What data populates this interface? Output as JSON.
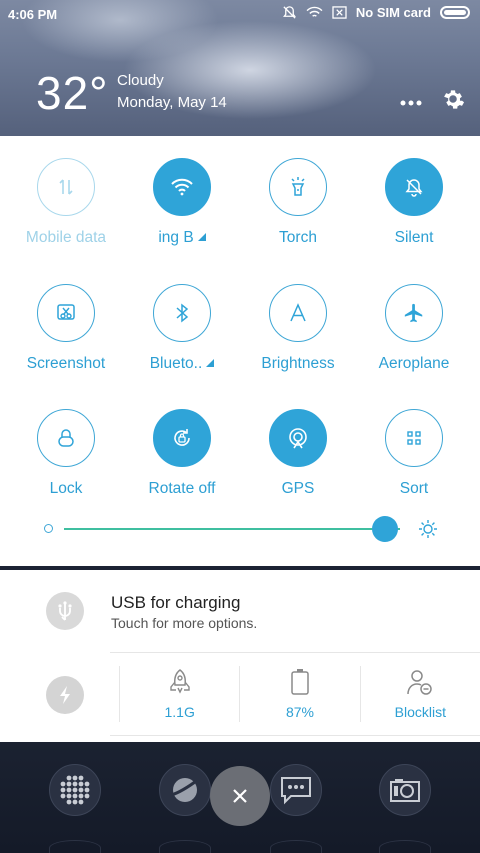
{
  "status_bar": {
    "time": "4:06 PM",
    "sim": "No SIM card"
  },
  "weather": {
    "temperature": "32°",
    "condition": "Cloudy",
    "date": "Monday, May 14"
  },
  "colors": {
    "accent": "#2fa4d8",
    "slider_track": "#3fbfa0"
  },
  "toggles": [
    {
      "label": "Mobile data",
      "icon": "mobile-data-icon",
      "state": "disabled"
    },
    {
      "label": "ing B",
      "icon": "wifi-icon",
      "state": "on",
      "has_menu": true
    },
    {
      "label": "Torch",
      "icon": "torch-icon",
      "state": "off"
    },
    {
      "label": "Silent",
      "icon": "silent-bell-icon",
      "state": "on"
    },
    {
      "label": "Screenshot",
      "icon": "screenshot-scissors-icon",
      "state": "off"
    },
    {
      "label": "Blueto..",
      "icon": "bluetooth-icon",
      "state": "off",
      "has_menu": true
    },
    {
      "label": "Brightness",
      "icon": "brightness-a-icon",
      "state": "off"
    },
    {
      "label": "Aeroplane",
      "icon": "aeroplane-icon",
      "state": "off"
    },
    {
      "label": "Lock",
      "icon": "lock-icon",
      "state": "off"
    },
    {
      "label": "Rotate off",
      "icon": "rotate-lock-icon",
      "state": "on"
    },
    {
      "label": "GPS",
      "icon": "gps-icon",
      "state": "on"
    },
    {
      "label": "Sort",
      "icon": "sort-grid-icon",
      "state": "off"
    }
  ],
  "brightness": {
    "level": 0.93
  },
  "notification": {
    "title": "USB for charging",
    "subtitle": "Touch for more options.",
    "actions": [
      {
        "label": "1.1G",
        "icon": "rocket-cleaner-icon"
      },
      {
        "label": "87%",
        "icon": "battery-icon"
      },
      {
        "label": "Blocklist",
        "icon": "blocklist-user-icon"
      }
    ]
  }
}
